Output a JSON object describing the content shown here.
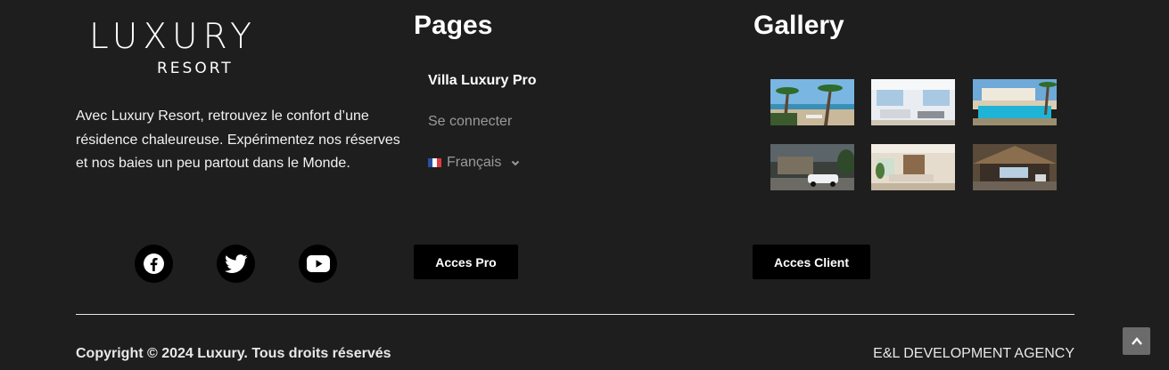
{
  "brand": {
    "logo_main": "LUXURY",
    "logo_sub": "RESORT"
  },
  "about": {
    "text": "Avec Luxury Resort, retrouvez le confort d’une résidence chaleureuse. Expérimentez nos réserves et nos baies un peu partout dans le Monde."
  },
  "social": [
    {
      "name": "facebook",
      "icon": "facebook-icon"
    },
    {
      "name": "twitter",
      "icon": "twitter-icon"
    },
    {
      "name": "youtube",
      "icon": "youtube-icon"
    }
  ],
  "pages": {
    "title": "Pages",
    "items": [
      "Villa Luxury Pro",
      "Se connecter"
    ],
    "language": {
      "label": "Français",
      "icon": "flag-fr-icon"
    },
    "button": "Acces Pro"
  },
  "gallery": {
    "title": "Gallery",
    "images": [
      {
        "icon": "beach-palms-image"
      },
      {
        "icon": "white-living-room-image"
      },
      {
        "icon": "pool-villa-image"
      },
      {
        "icon": "villa-car-image"
      },
      {
        "icon": "kitchen-interior-image"
      },
      {
        "icon": "thatched-lodge-image"
      }
    ],
    "button": "Acces Client"
  },
  "footer": {
    "copyright": "Copyright © 2024 Luxury. Tous droits réservés",
    "agency": "E&L DEVELOPMENT AGENCY"
  },
  "colors": {
    "background": "#1e1e1e",
    "button_bg": "#000000",
    "muted": "#9a9a9a"
  }
}
